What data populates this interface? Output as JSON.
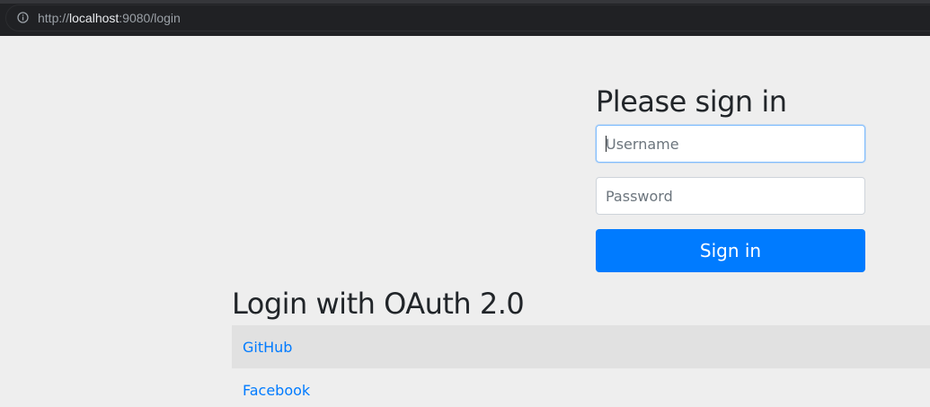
{
  "browser": {
    "url_scheme": "http://",
    "url_host": "localhost",
    "url_rest": ":9080/login",
    "info_icon": "info-circle-icon"
  },
  "login_form": {
    "heading": "Please sign in",
    "username_placeholder": "Username",
    "password_placeholder": "Password",
    "submit_label": "Sign in"
  },
  "oauth": {
    "heading": "Login with OAuth 2.0",
    "providers": [
      {
        "label": "GitHub"
      },
      {
        "label": "Facebook"
      }
    ]
  },
  "colors": {
    "primary": "#007bff",
    "page_background": "#eeeeee",
    "browser_bar": "#202124"
  }
}
